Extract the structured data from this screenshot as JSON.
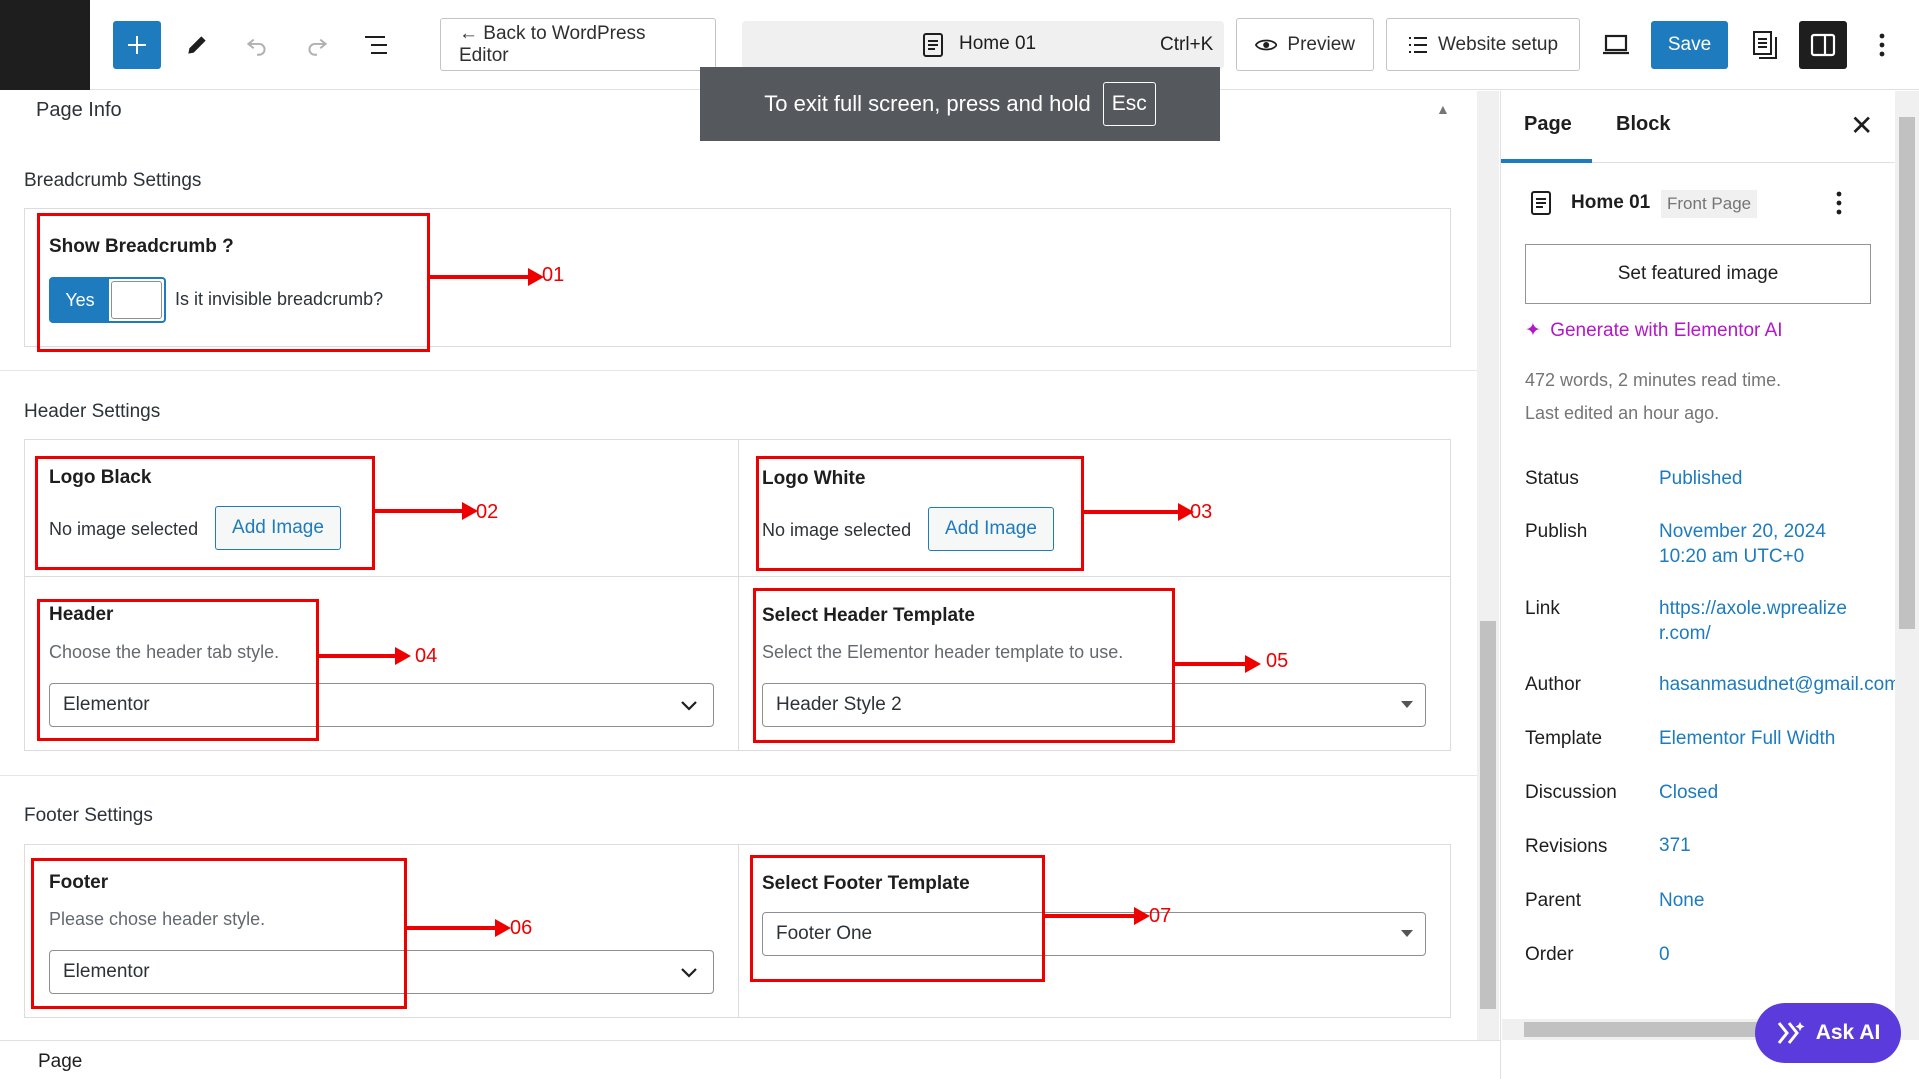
{
  "toolbar": {
    "back_label": "← Back to WordPress Editor",
    "doc_title": "Home 01",
    "shortcut": "Ctrl+K",
    "preview_label": "Preview",
    "website_setup_label": "Website setup",
    "save_label": "Save"
  },
  "toast": {
    "text": "To exit full screen, press and hold",
    "key": "Esc"
  },
  "main": {
    "panel_title": "Page Info",
    "breadcrumb": {
      "section_title": "Breadcrumb Settings",
      "field_label": "Show Breadcrumb ?",
      "toggle_value": "Yes",
      "toggle_hint": "Is it invisible breadcrumb?"
    },
    "header": {
      "section_title": "Header Settings",
      "logo_black_label": "Logo Black",
      "logo_black_status": "No image selected",
      "logo_black_button": "Add Image",
      "logo_white_label": "Logo White",
      "logo_white_status": "No image selected",
      "logo_white_button": "Add Image",
      "header_label": "Header",
      "header_desc": "Choose the header tab style.",
      "header_value": "Elementor",
      "template_label": "Select Header Template",
      "template_desc": "Select the Elementor header template to use.",
      "template_value": "Header Style 2"
    },
    "footer": {
      "section_title": "Footer Settings",
      "footer_label": "Footer",
      "footer_desc": "Please chose header style.",
      "footer_value": "Elementor",
      "template_label": "Select Footer Template",
      "template_value": "Footer One"
    }
  },
  "annotations": [
    "01",
    "02",
    "03",
    "04",
    "05",
    "06",
    "07"
  ],
  "sidebar": {
    "tab_page": "Page",
    "tab_block": "Block",
    "page_title": "Home 01",
    "page_badge": "Front Page",
    "featured_button": "Set featured image",
    "generate_ai": "Generate with Elementor AI",
    "word_count": "472 words, 2 minutes read time.",
    "last_edited": "Last edited an hour ago.",
    "rows": [
      {
        "label": "Status",
        "value": "Published"
      },
      {
        "label": "Publish",
        "value": "November 20, 2024",
        "value2": "10:20 am UTC+0"
      },
      {
        "label": "Link",
        "value": "https://axole.wprealize",
        "value2": "r.com/"
      },
      {
        "label": "Author",
        "value": "hasanmasudnet@gmail.com"
      },
      {
        "label": "Template",
        "value": "Elementor Full Width"
      },
      {
        "label": "Discussion",
        "value": "Closed"
      },
      {
        "label": "Revisions",
        "value": "371"
      },
      {
        "label": "Parent",
        "value": "None"
      },
      {
        "label": "Order",
        "value": "0"
      }
    ]
  },
  "ask_ai": "Ask AI",
  "footer_bar": "Page",
  "colors": {
    "accent": "#1d7bbe",
    "annotation": "#ee0000",
    "ai_purple": "#5b3bdb"
  }
}
